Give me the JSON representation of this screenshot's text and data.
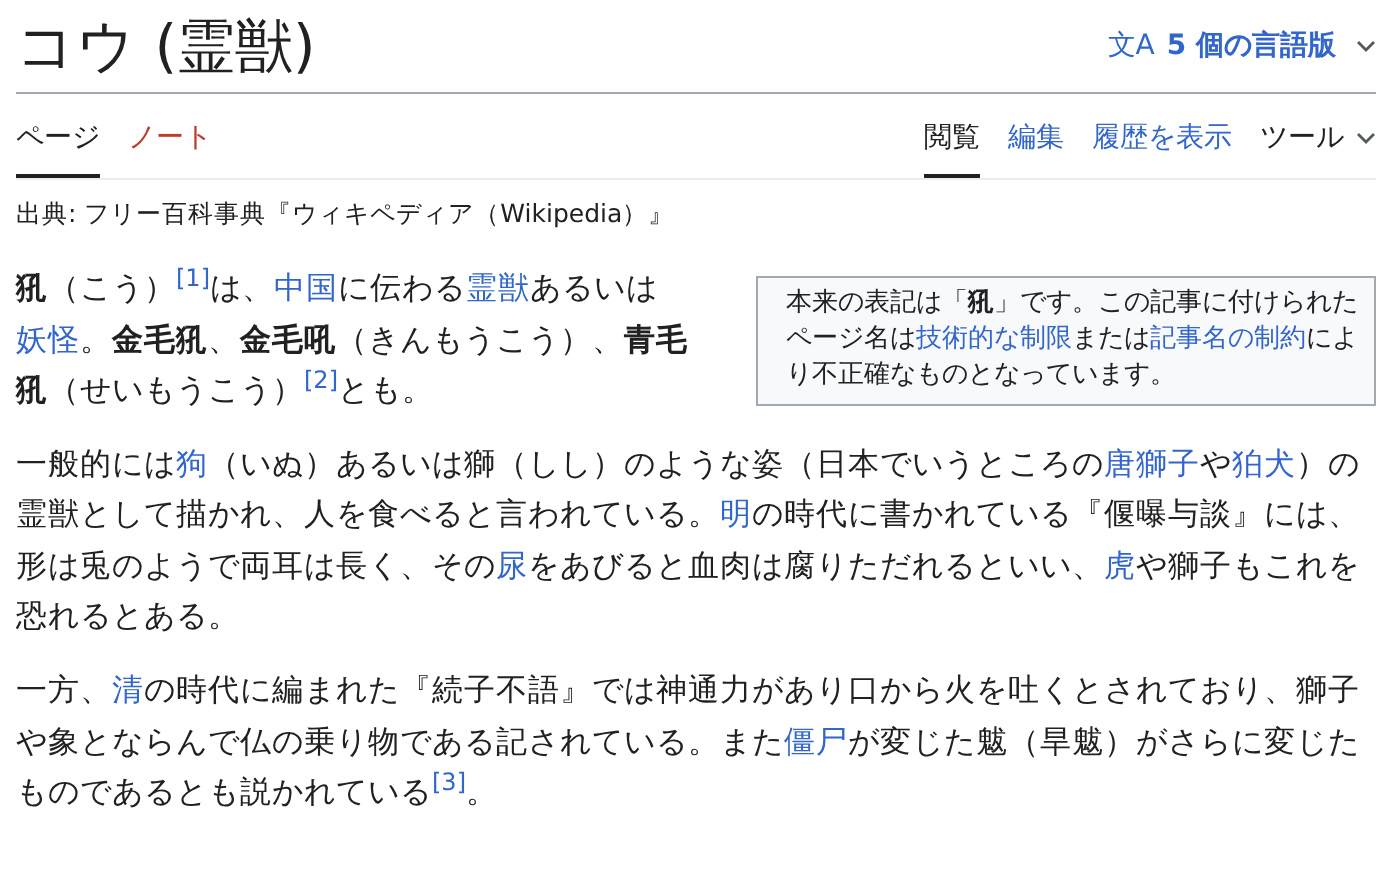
{
  "title": "コウ (霊獣)",
  "language_button": {
    "icon": "文A",
    "label": "5 個の言語版"
  },
  "namespace_tabs": [
    {
      "label": "ページ",
      "selected": true,
      "missing": false
    },
    {
      "label": "ノート",
      "selected": false,
      "missing": true
    }
  ],
  "view_tabs": [
    {
      "label": "閲覧",
      "selected": true,
      "kind": "tab"
    },
    {
      "label": "編集",
      "selected": false,
      "kind": "tab"
    },
    {
      "label": "履歴を表示",
      "selected": false,
      "kind": "tab"
    },
    {
      "label": "ツール",
      "selected": false,
      "kind": "menu"
    }
  ],
  "source_line": "出典: フリー百科事典『ウィキペディア（Wikipedia）』",
  "notice": [
    {
      "kind": "text",
      "text": "本来の表記は「"
    },
    {
      "kind": "bold",
      "text": "犼"
    },
    {
      "kind": "text",
      "text": "」です。この記事に付けられたページ名は"
    },
    {
      "kind": "link",
      "text": "技術的な制限"
    },
    {
      "kind": "text",
      "text": "または"
    },
    {
      "kind": "link",
      "text": "記事名の制約"
    },
    {
      "kind": "text",
      "text": "により不正確なものとなっています。"
    }
  ],
  "paragraphs": [
    [
      {
        "kind": "bold",
        "text": "犼"
      },
      {
        "kind": "text",
        "text": "（こう）"
      },
      {
        "kind": "ref",
        "text": "[1]"
      },
      {
        "kind": "text",
        "text": "は、"
      },
      {
        "kind": "link",
        "text": "中国"
      },
      {
        "kind": "text",
        "text": "に伝わる"
      },
      {
        "kind": "link",
        "text": "霊獣"
      },
      {
        "kind": "text",
        "text": "あるいは"
      },
      {
        "kind": "link",
        "text": "妖怪"
      },
      {
        "kind": "text",
        "text": "。"
      },
      {
        "kind": "bold",
        "text": "金毛犼"
      },
      {
        "kind": "text",
        "text": "、"
      },
      {
        "kind": "bold",
        "text": "金毛吼"
      },
      {
        "kind": "text",
        "text": "（きんもうこう）、"
      },
      {
        "kind": "bold",
        "text": "青毛犼"
      },
      {
        "kind": "text",
        "text": "（せいもうこう）"
      },
      {
        "kind": "ref",
        "text": "[2]"
      },
      {
        "kind": "text",
        "text": "とも。"
      }
    ],
    [
      {
        "kind": "text",
        "text": "一般的には"
      },
      {
        "kind": "link",
        "text": "狗"
      },
      {
        "kind": "text",
        "text": "（いぬ）あるいは獅（しし）のような姿（日本でいうところの"
      },
      {
        "kind": "link",
        "text": "唐獅子"
      },
      {
        "kind": "text",
        "text": "や"
      },
      {
        "kind": "link",
        "text": "狛犬"
      },
      {
        "kind": "text",
        "text": "）の霊獣として描かれ、人を食べると言われている。"
      },
      {
        "kind": "link",
        "text": "明"
      },
      {
        "kind": "text",
        "text": "の時代に書かれている『偃曝与談』には、形は兎のようで両耳は長く、その"
      },
      {
        "kind": "link",
        "text": "尿"
      },
      {
        "kind": "text",
        "text": "をあびると血肉は腐りただれるといい、"
      },
      {
        "kind": "link",
        "text": "虎"
      },
      {
        "kind": "text",
        "text": "や獅子もこれを恐れるとある。"
      }
    ],
    [
      {
        "kind": "text",
        "text": "一方、"
      },
      {
        "kind": "link",
        "text": "清"
      },
      {
        "kind": "text",
        "text": "の時代に編まれた『続子不語』では神通力があり口から火を吐くとされており、獅子や象とならんで仏の乗り物である記されている。また"
      },
      {
        "kind": "link",
        "text": "僵尸"
      },
      {
        "kind": "text",
        "text": "が変じた魃（旱魃）がさらに変じたものであるとも説かれている"
      },
      {
        "kind": "ref",
        "text": "[3]"
      },
      {
        "kind": "text",
        "text": "。"
      }
    ]
  ]
}
